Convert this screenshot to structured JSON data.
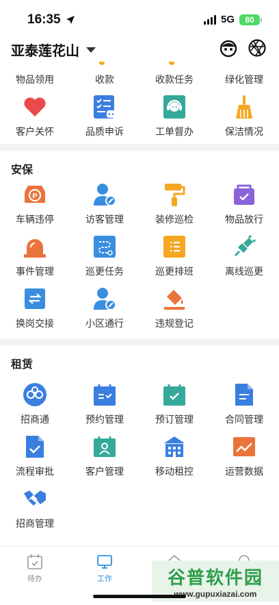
{
  "status_bar": {
    "time": "16:35",
    "network": "5G",
    "battery": "80"
  },
  "header": {
    "community": "亚泰莲花山",
    "icons": [
      "robot-avatar-icon",
      "camera-aperture-icon"
    ]
  },
  "top_partial_row": [
    {
      "label": "物品领用"
    },
    {
      "label": "收款"
    },
    {
      "label": "收款任务"
    },
    {
      "label": "绿化管理"
    }
  ],
  "row_general": [
    {
      "label": "客户关怀",
      "icon": "heart-icon",
      "color": "#e94b4b"
    },
    {
      "label": "品质申诉",
      "icon": "checklist-chat-icon",
      "color": "#3a7ee0"
    },
    {
      "label": "工单督办",
      "icon": "headset-agent-icon",
      "color": "#35a99a"
    },
    {
      "label": "保洁情况",
      "icon": "broom-icon",
      "color": "#f5a623"
    }
  ],
  "security": {
    "title": "安保",
    "rows": [
      [
        {
          "label": "车辆违停",
          "icon": "parking-violation-icon",
          "color": "#e9743b"
        },
        {
          "label": "访客管理",
          "icon": "visitor-icon",
          "color": "#3a8ee0"
        },
        {
          "label": "装修巡检",
          "icon": "paint-roller-icon",
          "color": "#f5a623"
        },
        {
          "label": "物品放行",
          "icon": "package-check-icon",
          "color": "#8a63d9"
        }
      ],
      [
        {
          "label": "事件管理",
          "icon": "alarm-light-icon",
          "color": "#e9743b"
        },
        {
          "label": "巡更任务",
          "icon": "patrol-route-icon",
          "color": "#3a8ee0"
        },
        {
          "label": "巡更排班",
          "icon": "schedule-list-icon",
          "color": "#f5a623"
        },
        {
          "label": "离线巡更",
          "icon": "plug-icon",
          "color": "#35a99a"
        }
      ],
      [
        {
          "label": "换岗交接",
          "icon": "shift-swap-icon",
          "color": "#3a8ee0"
        },
        {
          "label": "小区通行",
          "icon": "resident-pass-icon",
          "color": "#3a8ee0"
        },
        {
          "label": "违规登记",
          "icon": "paint-bucket-icon",
          "color": "#e9743b"
        }
      ]
    ]
  },
  "leasing": {
    "title": "租赁",
    "rows": [
      [
        {
          "label": "招商通",
          "icon": "swirl-logo-icon",
          "color": "#3a7ee0"
        },
        {
          "label": "预约管理",
          "icon": "calendar-equals-icon",
          "color": "#3a7ee0"
        },
        {
          "label": "预订管理",
          "icon": "calendar-check-icon",
          "color": "#35a99a"
        },
        {
          "label": "合同管理",
          "icon": "document-icon",
          "color": "#3a7ee0"
        }
      ],
      [
        {
          "label": "流程审批",
          "icon": "document-check-icon",
          "color": "#3a7ee0"
        },
        {
          "label": "客户管理",
          "icon": "customer-card-icon",
          "color": "#35a99a"
        },
        {
          "label": "移动租控",
          "icon": "building-icon",
          "color": "#3a7ee0"
        },
        {
          "label": "运营数据",
          "icon": "trend-chart-icon",
          "color": "#e9743b"
        }
      ],
      [
        {
          "label": "招商管理",
          "icon": "handshake-icon",
          "color": "#3a7ee0"
        }
      ]
    ]
  },
  "bottom_nav": [
    {
      "label": "待办",
      "icon": "todo-calendar-icon",
      "active": false
    },
    {
      "label": "工作",
      "icon": "monitor-icon",
      "active": true
    },
    {
      "label": "",
      "icon": "home-icon",
      "active": false
    },
    {
      "label": "",
      "icon": "profile-icon",
      "active": false
    }
  ],
  "watermark": {
    "title": "谷普软件园",
    "url": "www.gupuxiazai.com"
  }
}
